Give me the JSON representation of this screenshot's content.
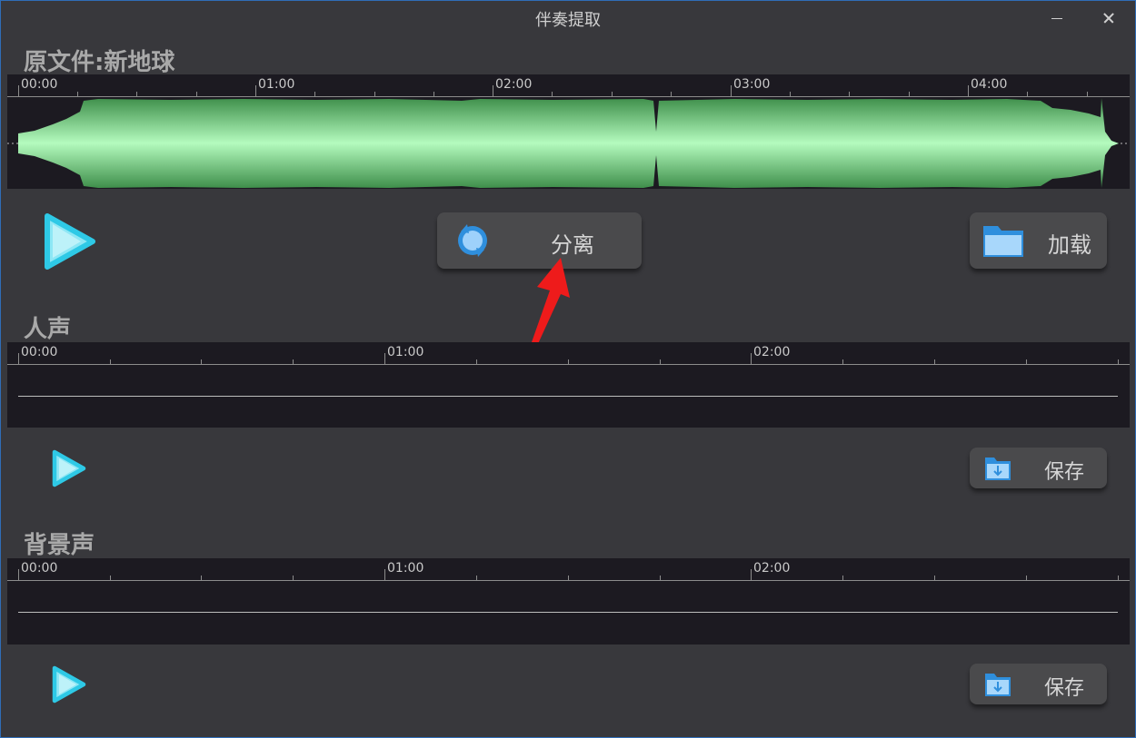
{
  "window": {
    "title": "伴奏提取"
  },
  "original": {
    "label": "原文件:新地球",
    "ticks": [
      "00:00",
      "01:00",
      "02:00",
      "03:00",
      "04:00"
    ],
    "waveform_color": "#9df5a8"
  },
  "controls": {
    "separate_label": "分离",
    "load_label": "加载"
  },
  "vocal": {
    "label": "人声",
    "ticks": [
      "00:00",
      "01:00",
      "02:00"
    ],
    "save_label": "保存"
  },
  "background": {
    "label": "背景声",
    "ticks": [
      "00:00",
      "01:00",
      "02:00"
    ],
    "save_label": "保存"
  },
  "colors": {
    "accent_play": "#2ec9e6",
    "folder_icon": "#4aa3ee",
    "annotation_arrow": "#ee1b1b"
  }
}
